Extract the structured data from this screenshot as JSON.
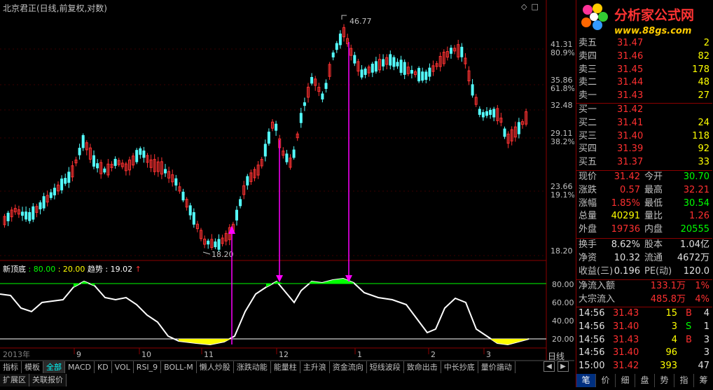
{
  "header": {
    "title": "北京君正(日线,前复权,对数)"
  },
  "price_axis": {
    "levels": [
      {
        "price": "41.31",
        "pct": "80.9%"
      },
      {
        "price": "35.86",
        "pct": "61.8%"
      },
      {
        "price": "32.48",
        "pct": ""
      },
      {
        "price": "29.11",
        "pct": "38.2%"
      },
      {
        "price": "23.66",
        "pct": "19.1%"
      },
      {
        "price": "18.20",
        "pct": ""
      }
    ],
    "high_label": "46.77",
    "low_label": "18.20"
  },
  "indicator": {
    "name": "新顶底",
    "val1": ": 80.00",
    "val2": ": 20.00",
    "trend_label": "趋势",
    "trend_value": ": 19.02",
    "arrow": "↑",
    "axis": [
      "80.00",
      "60.00",
      "40.00",
      "20.00"
    ]
  },
  "time_axis": {
    "year_label": "2013年",
    "months": [
      "9",
      "10",
      "11",
      "12",
      "1",
      "2",
      "3"
    ],
    "period": "日线"
  },
  "tabs": [
    "指标",
    "模板",
    "全部",
    "MACD",
    "KD",
    "VOL",
    "RSI_9",
    "BOLL-M",
    "懒人炒股",
    "涨跌动能",
    "能量柱",
    "主升浪",
    "资金流向",
    "短线波段",
    "致命出击",
    "中长抄底",
    "量价諧动"
  ],
  "bottom_tabs": [
    "扩展区",
    "关联报价"
  ],
  "logo": {
    "title": "分析家公式网",
    "url": "www.88gs.com"
  },
  "orderbook": {
    "asks": [
      {
        "label": "卖五",
        "price": "31.47",
        "vol": "2"
      },
      {
        "label": "卖四",
        "price": "31.46",
        "vol": "82"
      },
      {
        "label": "卖三",
        "price": "31.45",
        "vol": "178"
      },
      {
        "label": "卖二",
        "price": "31.44",
        "vol": "48"
      },
      {
        "label": "卖一",
        "price": "31.43",
        "vol": "27"
      }
    ],
    "bids": [
      {
        "label": "买一",
        "price": "31.42",
        "vol": ""
      },
      {
        "label": "买二",
        "price": "31.41",
        "vol": "24"
      },
      {
        "label": "买三",
        "price": "31.40",
        "vol": "118"
      },
      {
        "label": "买四",
        "price": "31.39",
        "vol": "92"
      },
      {
        "label": "买五",
        "price": "31.37",
        "vol": "33"
      }
    ]
  },
  "quote": [
    {
      "l1": "现价",
      "v1": "31.42",
      "c1": "red",
      "l2": "今开",
      "v2": "30.70",
      "c2": "grn"
    },
    {
      "l1": "涨跌",
      "v1": "0.57",
      "c1": "red",
      "l2": "最高",
      "v2": "32.21",
      "c2": "red"
    },
    {
      "l1": "涨幅",
      "v1": "1.85%",
      "c1": "red",
      "l2": "最低",
      "v2": "30.54",
      "c2": "grn"
    },
    {
      "l1": "总量",
      "v1": "40291",
      "c1": "yel",
      "l2": "量比",
      "v2": "1.26",
      "c2": "red"
    },
    {
      "l1": "外盘",
      "v1": "19736",
      "c1": "red",
      "l2": "内盘",
      "v2": "20555",
      "c2": "grn"
    }
  ],
  "stats": [
    {
      "l1": "换手",
      "v1": "8.62%",
      "l2": "股本",
      "v2": "1.04亿"
    },
    {
      "l1": "净资",
      "v1": "10.32",
      "l2": "流通",
      "v2": "4672万"
    },
    {
      "l1": "收益(三)",
      "v1": "0.196",
      "l2": "PE(动)",
      "v2": "120.0"
    }
  ],
  "flows": [
    {
      "label": "净流入额",
      "value": "133.1万",
      "pct": "1%"
    },
    {
      "label": "大宗流入",
      "value": "485.8万",
      "pct": "4%"
    }
  ],
  "ticks": [
    {
      "time": "14:56",
      "price": "31.43",
      "vol": "15",
      "side": "B",
      "n": "4"
    },
    {
      "time": "14:56",
      "price": "31.40",
      "vol": "3",
      "side": "S",
      "n": "1"
    },
    {
      "time": "14:56",
      "price": "31.43",
      "vol": "4",
      "side": "B",
      "n": "3"
    },
    {
      "time": "14:56",
      "price": "31.40",
      "vol": "96",
      "side": "",
      "n": "3"
    },
    {
      "time": "15:00",
      "price": "31.42",
      "vol": "393",
      "side": "",
      "n": "47"
    }
  ],
  "panel_tabs": [
    "笔",
    "价",
    "细",
    "盘",
    "势",
    "指",
    "筹"
  ],
  "colors": {
    "up": "#ff3232",
    "down": "#54ffff",
    "panel_border": "#8b0000",
    "indicator_line": "#ffffff",
    "overbought": "#00ff00",
    "oversold": "#ffff00",
    "signal": "#ff00ff"
  }
}
